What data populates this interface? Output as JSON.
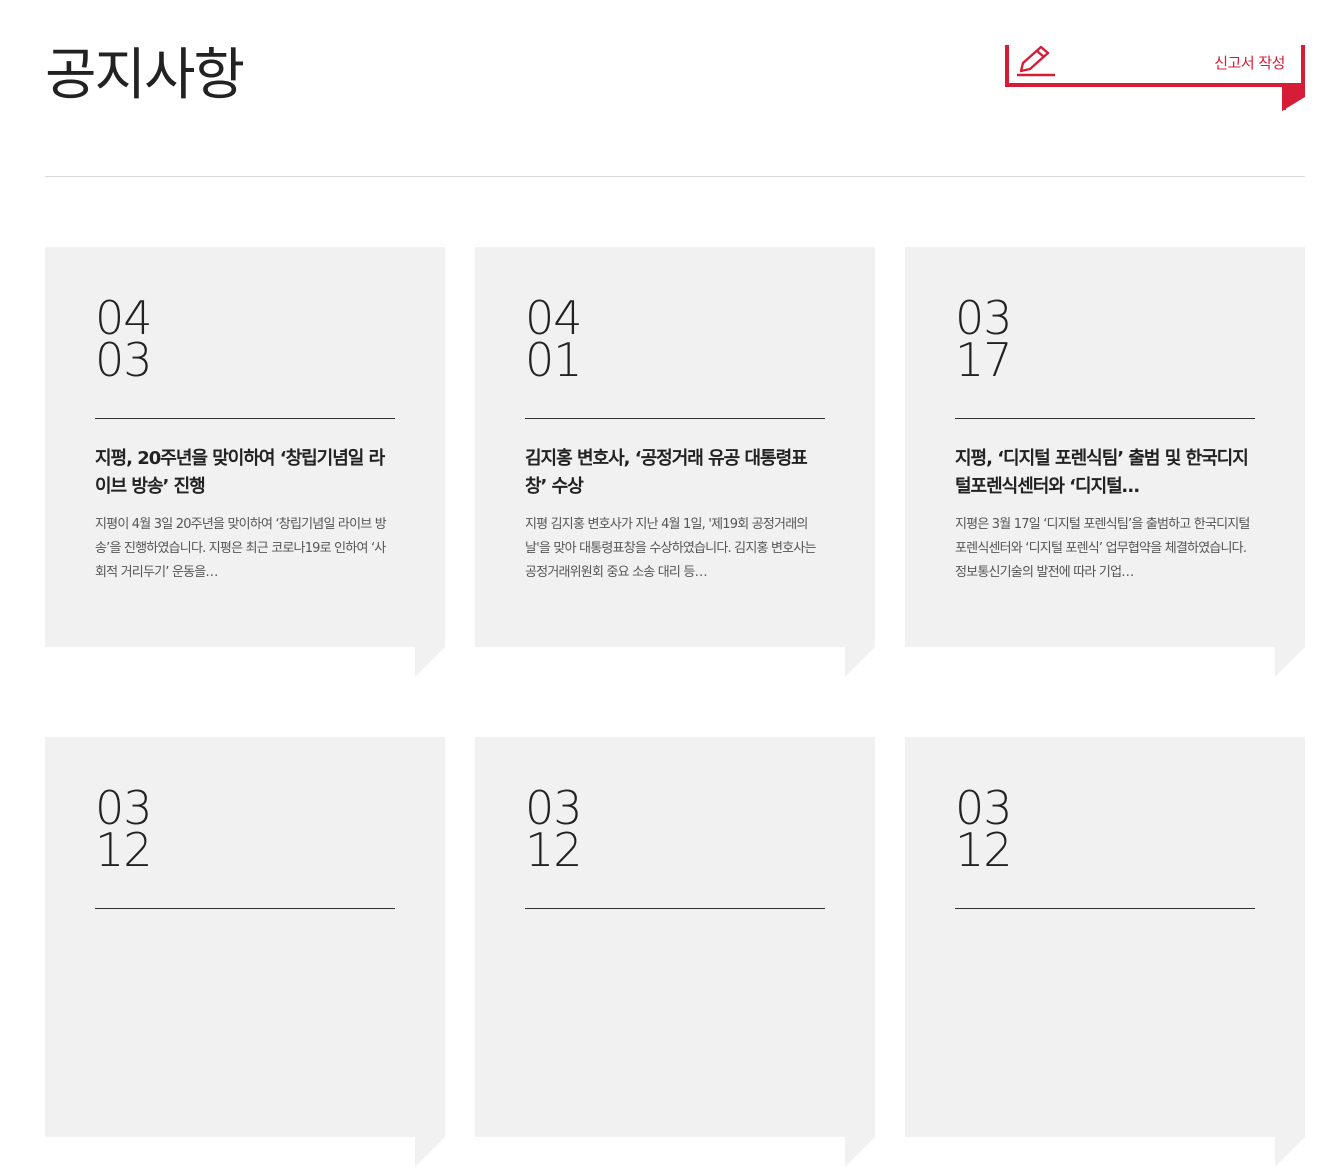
{
  "page": {
    "title": "공지사항"
  },
  "report_button": {
    "label": "신고서 작성",
    "icon": "pencil-icon",
    "accent": "#d71c38"
  },
  "colors": {
    "card_bg": "#f1f1f1",
    "accent": "#d71c38",
    "divider": "#d8d8d8"
  },
  "notices": [
    {
      "month": "04",
      "day": "03",
      "title": "지평, 20주년을 맞이하여 ‘창립기념일 라이브 방송’ 진행",
      "summary": "지평이 4월 3일 20주년을 맞이하여 ‘창립기념일 라이브 방송’을 진행하였습니다.  지평은 최근 코로나19로 인하여 ‘사회적 거리두기’ 운동을…"
    },
    {
      "month": "04",
      "day": "01",
      "title": "김지홍 변호사, ‘공정거래 유공 대통령표창’ 수상",
      "summary": "지평 김지홍 변호사가 지난 4월 1일, '제19회 공정거래의 날'을 맞아 대통령표창을 수상하였습니다. 김지홍 변호사는 공정거래위원회 중요 소송 대리 등…"
    },
    {
      "month": "03",
      "day": "17",
      "title": "지평, ‘디지털 포렌식팀’ 출범 및 한국디지털포렌식센터와 ‘디지털…",
      "summary": "지평은 3월 17일 ‘디지털 포렌식팀’을 출범하고 한국디지털포렌식센터와 ‘디지털 포렌식’ 업무협약을 체결하였습니다. 정보통신기술의 발전에 따라 기업…"
    },
    {
      "month": "03",
      "day": "12",
      "title": "",
      "summary": ""
    },
    {
      "month": "03",
      "day": "12",
      "title": "",
      "summary": ""
    },
    {
      "month": "03",
      "day": "12",
      "title": "",
      "summary": ""
    }
  ]
}
